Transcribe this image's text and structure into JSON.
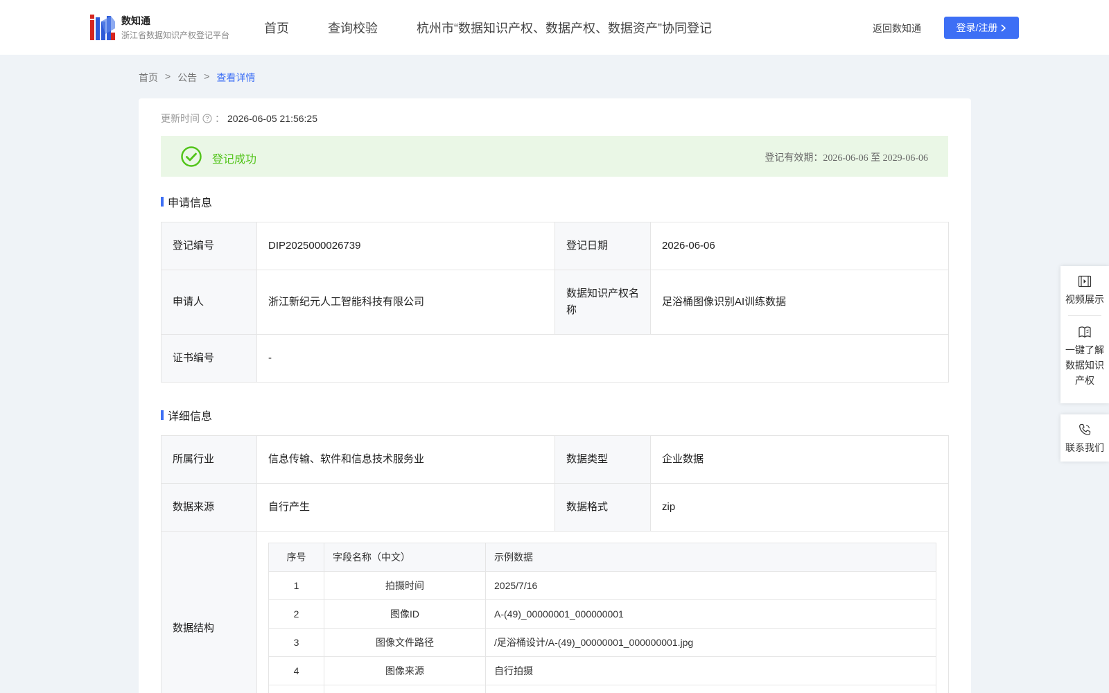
{
  "header": {
    "brand_name": "数知通",
    "brand_sub": "浙江省数据知识产权登记平台",
    "nav": [
      "首页",
      "查询校验",
      "杭州市“数据知识产权、数据产权、数据资产”协同登记"
    ],
    "back_link": "返回数知通",
    "login_button": "登录/注册"
  },
  "breadcrumb": {
    "items": [
      "首页",
      "公告",
      "查看详情"
    ],
    "separator": ">"
  },
  "update": {
    "label": "更新时间",
    "colon": "：",
    "value": "2026-06-05 21:56:25"
  },
  "status": {
    "text": "登记成功",
    "validity": "登记有效期：2026-06-06 至 2029-06-06",
    "color": "#52c41a"
  },
  "application_info": {
    "title": "申请信息",
    "rows": [
      {
        "label1": "登记编号",
        "value1": "DIP2025000026739",
        "label2": "登记日期",
        "value2": "2026-06-06"
      },
      {
        "label1": "申请人",
        "value1": "浙江新纪元人工智能科技有限公司",
        "label2": "数据知识产权名称",
        "value2": "足浴桶图像识别AI训练数据"
      },
      {
        "label1": "证书编号",
        "value1": "-"
      }
    ]
  },
  "detail_info": {
    "title": "详细信息",
    "rows": [
      {
        "label1": "所属行业",
        "value1": "信息传输、软件和信息技术服务业",
        "label2": "数据类型",
        "value2": "企业数据"
      },
      {
        "label1": "数据来源",
        "value1": "自行产生",
        "label2": "数据格式",
        "value2": "zip"
      }
    ],
    "structure_label": "数据结构",
    "structure_table": {
      "headers": [
        "序号",
        "字段名称（中文）",
        "示例数据"
      ],
      "rows": [
        [
          "1",
          "拍摄时间",
          "2025/7/16"
        ],
        [
          "2",
          "图像ID",
          "A-(49)_00000001_000000001"
        ],
        [
          "3",
          "图像文件路径",
          "/足浴桶设计/A-(49)_00000001_000000001.jpg"
        ],
        [
          "4",
          "图像来源",
          "自行拍摄"
        ],
        [
          "",
          "",
          ""
        ]
      ]
    }
  },
  "side_widget": {
    "video": "视频展示",
    "learn_lines": [
      "一键了解",
      "数据知识",
      "产权"
    ],
    "contact": "联系我们"
  },
  "colors": {
    "accent": "#3d6ff5",
    "success_bg": "#eaf7e6"
  }
}
